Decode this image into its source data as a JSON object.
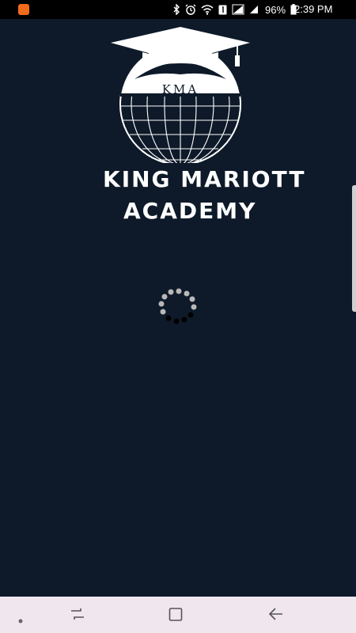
{
  "status_bar": {
    "battery_percent": "96%",
    "time": "2:39 PM",
    "icons": [
      "app-notification-icon",
      "bluetooth-icon",
      "alarm-icon",
      "wifi-icon",
      "sim-1-icon",
      "signal-icon",
      "battery-icon"
    ],
    "notification_color": "#f26a1b"
  },
  "app": {
    "logo_text": "KMA",
    "title_line1": "KING MARIOTT",
    "title_line2": "ACADEMY",
    "background_color": "#0e1a29"
  },
  "nav_bar": {
    "items": [
      "dot",
      "recents",
      "home",
      "back"
    ],
    "background_color": "#efe6ee"
  }
}
